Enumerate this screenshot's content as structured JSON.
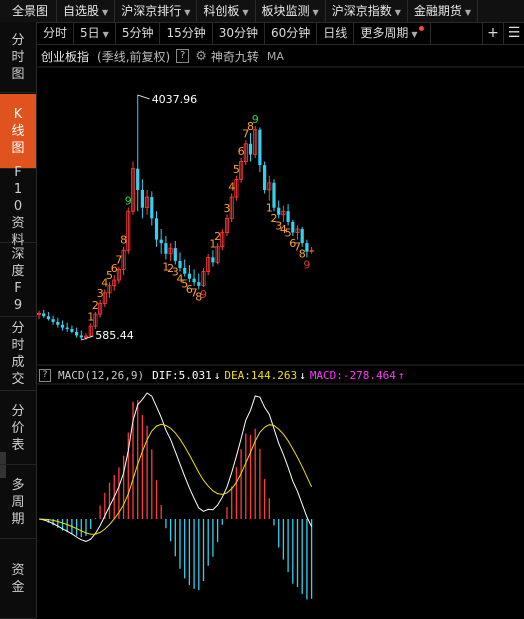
{
  "topbar": {
    "items": [
      {
        "label": "全景图",
        "dropdown": false
      },
      {
        "label": "自选股",
        "dropdown": true
      },
      {
        "label": "沪深京排行",
        "dropdown": true
      },
      {
        "label": "科创板",
        "dropdown": true
      },
      {
        "label": "板块监测",
        "dropdown": true
      },
      {
        "label": "沪深京指数",
        "dropdown": true
      },
      {
        "label": "金融期货",
        "dropdown": true
      }
    ]
  },
  "sidebar": {
    "items": [
      {
        "label": "分时图",
        "active": false
      },
      {
        "label": "K线图",
        "active": true
      },
      {
        "label": "F10资料",
        "active": false
      },
      {
        "label": "深度F9",
        "active": false
      },
      {
        "label": "分时成交",
        "active": false
      },
      {
        "label": "分价表",
        "active": false
      },
      {
        "label": "多周期",
        "active": false
      },
      {
        "label": "资金",
        "active": false
      }
    ]
  },
  "periods": {
    "items": [
      {
        "label": "分时",
        "dropdown": false
      },
      {
        "label": "5日",
        "dropdown": true
      },
      {
        "label": "5分钟",
        "dropdown": false
      },
      {
        "label": "15分钟",
        "dropdown": false
      },
      {
        "label": "30分钟",
        "dropdown": false
      },
      {
        "label": "60分钟",
        "dropdown": false
      },
      {
        "label": "日线",
        "dropdown": false
      },
      {
        "label": "更多周期",
        "dropdown": true
      }
    ],
    "add_icon": "+",
    "grid_icon": "☰"
  },
  "chart_header": {
    "title": "创业板指",
    "subtitle": "(季线,前复权)",
    "help": "?",
    "indicator": "神奇九转",
    "ma": "MA"
  },
  "price_labels": {
    "high": "4037.96",
    "low": "585.44"
  },
  "macd": {
    "help": "?",
    "label": "MACD(12,26,9)",
    "dif": "DIF:5.031",
    "dif_arrow": "↓",
    "dea": "DEA:144.263",
    "dea_arrow": "↓",
    "macd": "MACD:-278.464",
    "macd_arrow": "↑"
  },
  "colors": {
    "up": "#ff3c3c",
    "down": "#33d0f0",
    "dif_line": "#ffffff",
    "dea_line": "#f0e000",
    "nine_orange": "#ffa033",
    "nine_green": "#33d040",
    "nine_red": "#e83030",
    "active_tab": "#e0531e"
  },
  "chart_data": {
    "type": "candlestick",
    "title": "创业板指",
    "series": [
      {
        "name": "K",
        "values": [
          [
            950,
            1000,
            880,
            960
          ],
          [
            960,
            1010,
            900,
            920
          ],
          [
            920,
            980,
            860,
            880
          ],
          [
            880,
            930,
            800,
            840
          ],
          [
            840,
            900,
            760,
            800
          ],
          [
            800,
            860,
            720,
            760
          ],
          [
            760,
            830,
            700,
            740
          ],
          [
            740,
            790,
            680,
            700
          ],
          [
            700,
            760,
            620,
            650
          ],
          [
            650,
            720,
            585.44,
            620
          ],
          [
            620,
            680,
            590,
            640
          ],
          [
            640,
            820,
            620,
            780
          ],
          [
            780,
            980,
            740,
            950
          ],
          [
            950,
            1150,
            900,
            1100
          ],
          [
            1100,
            1300,
            1050,
            1250
          ],
          [
            1250,
            1400,
            1180,
            1350
          ],
          [
            1350,
            1500,
            1280,
            1430
          ],
          [
            1430,
            1620,
            1380,
            1580
          ],
          [
            1580,
            1900,
            1500,
            1850
          ],
          [
            1850,
            2450,
            1800,
            2400
          ],
          [
            2400,
            3100,
            2350,
            3000
          ],
          [
            3000,
            4037.96,
            2400,
            2700
          ],
          [
            2700,
            2850,
            2300,
            2450
          ],
          [
            2450,
            2700,
            2350,
            2600
          ],
          [
            2600,
            2680,
            2200,
            2300
          ],
          [
            2300,
            2400,
            1900,
            2000
          ],
          [
            2000,
            2150,
            1800,
            1950
          ],
          [
            1950,
            2050,
            1720,
            1800
          ],
          [
            1800,
            1950,
            1700,
            1880
          ],
          [
            1880,
            1980,
            1650,
            1700
          ],
          [
            1700,
            1820,
            1550,
            1600
          ],
          [
            1600,
            1720,
            1480,
            1520
          ],
          [
            1520,
            1640,
            1400,
            1450
          ],
          [
            1450,
            1580,
            1350,
            1400
          ],
          [
            1400,
            1520,
            1300,
            1350
          ],
          [
            1350,
            1600,
            1330,
            1550
          ],
          [
            1550,
            1800,
            1500,
            1750
          ],
          [
            1750,
            1850,
            1620,
            1680
          ],
          [
            1680,
            1950,
            1650,
            1900
          ],
          [
            1900,
            2150,
            1850,
            2100
          ],
          [
            2100,
            2350,
            2050,
            2300
          ],
          [
            2300,
            2650,
            2250,
            2600
          ],
          [
            2600,
            2900,
            2550,
            2850
          ],
          [
            2850,
            3150,
            2800,
            3100
          ],
          [
            3100,
            3400,
            3050,
            3350
          ],
          [
            3350,
            3500,
            3100,
            3200
          ],
          [
            3200,
            3600,
            3150,
            3550
          ],
          [
            3550,
            3580,
            2950,
            3050
          ],
          [
            3050,
            3100,
            2650,
            2700
          ],
          [
            2700,
            2900,
            2550,
            2800
          ],
          [
            2800,
            2850,
            2400,
            2450
          ],
          [
            2450,
            2550,
            2300,
            2350
          ],
          [
            2350,
            2480,
            2250,
            2400
          ],
          [
            2400,
            2500,
            2200,
            2250
          ],
          [
            2250,
            2280,
            2050,
            2100
          ],
          [
            2100,
            2200,
            2000,
            2150
          ],
          [
            2150,
            2180,
            1900,
            1950
          ],
          [
            1950,
            2000,
            1750,
            1830
          ],
          [
            1830,
            1900,
            1800,
            1850
          ]
        ]
      }
    ],
    "annotations": [
      "4037.96",
      "585.44"
    ]
  }
}
